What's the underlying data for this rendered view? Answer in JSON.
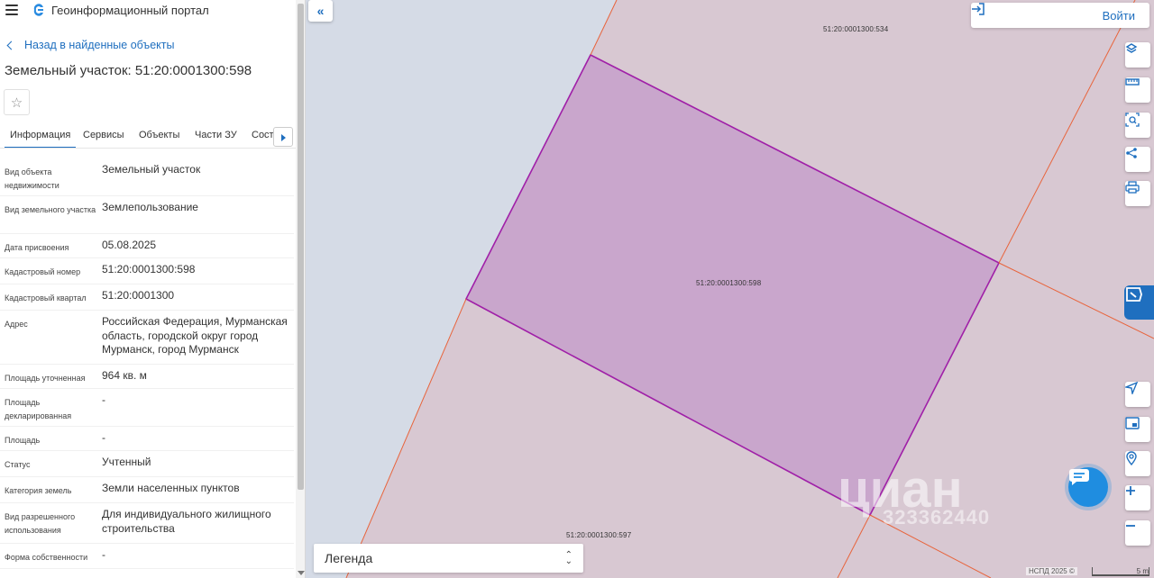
{
  "header": {
    "portal_title": "Геоинформационный портал"
  },
  "panel": {
    "back_label": "Назад в найденные объекты",
    "object_title": "Земельный участок: 51:20:0001300:598",
    "tabs": [
      {
        "label": "Информация"
      },
      {
        "label": "Сервисы"
      },
      {
        "label": "Объекты"
      },
      {
        "label": "Части ЗУ"
      },
      {
        "label": "Состав"
      }
    ],
    "active_tab": "Информация",
    "properties": [
      {
        "label": "Вид объекта недвижимости",
        "value": "Земельный участок"
      },
      {
        "label": "Вид земельного участка",
        "value": "Землепользование"
      },
      {
        "label": "Дата присвоения",
        "value": "05.08.2025"
      },
      {
        "label": "Кадастровый номер",
        "value": "51:20:0001300:598"
      },
      {
        "label": "Кадастровый квартал",
        "value": "51:20:0001300"
      },
      {
        "label": "Адрес",
        "value": "Российская Федерация, Мурманская область, городской округ город Мурманск, город Мурманск"
      },
      {
        "label": "Площадь уточненная",
        "value": "964 кв. м"
      },
      {
        "label": "Площадь декларированная",
        "value": "-"
      },
      {
        "label": "Площадь",
        "value": "-"
      },
      {
        "label": "Статус",
        "value": "Учтенный"
      },
      {
        "label": "Категория земель",
        "value": "Земли населенных пунктов"
      },
      {
        "label": "Вид разрешенного использования",
        "value": "Для индивидуального жилищного строительства"
      },
      {
        "label": "Форма собственности",
        "value": "-"
      }
    ]
  },
  "map": {
    "login_label": "Войти",
    "legend_label": "Легенда",
    "parcel_labels": {
      "top": "51:20:0001300:534",
      "center": "51:20:0001300:598",
      "bottom": "51:20:0001300:597"
    },
    "watermark": {
      "brand": "циан",
      "number": "323362440"
    },
    "attribution": "НСПД 2025 ©",
    "scale_label": "5 m",
    "colors": {
      "accent": "#1f6fbf",
      "selected_parcel": "#c9a6cc",
      "parcel_border": "#a020a8",
      "boundary": "#e8643c"
    }
  }
}
